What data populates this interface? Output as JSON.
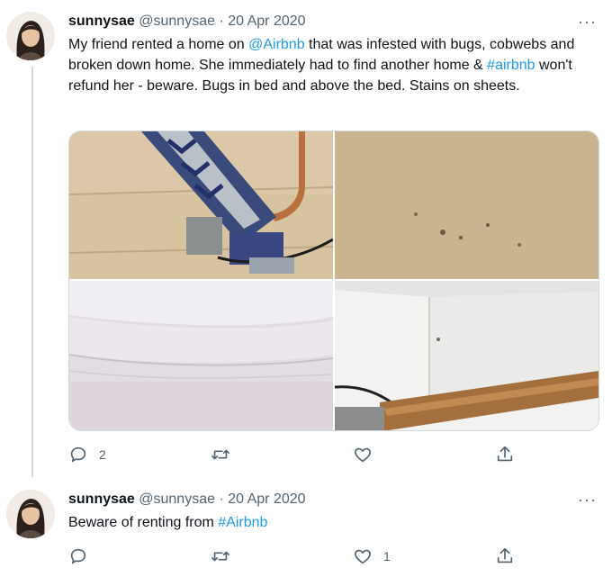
{
  "tweets": [
    {
      "name": "sunnysae",
      "handle": "@sunnysae",
      "separator": "·",
      "date": "20 Apr 2020",
      "text_parts": [
        {
          "t": "My friend rented a home on ",
          "link": false
        },
        {
          "t": "@Airbnb",
          "link": true
        },
        {
          "t": " that was infested with bugs, cobwebs and broken down home. She immediately had to find another home & ",
          "link": false
        },
        {
          "t": "#airbnb",
          "link": true
        },
        {
          "t": " won't refund her - beware. Bugs in bed and above the bed. Stains on sheets.",
          "link": false
        }
      ],
      "reply_count": "2",
      "retweet_count": "",
      "like_count": "",
      "has_media": true
    },
    {
      "name": "sunnysae",
      "handle": "@sunnysae",
      "separator": "·",
      "date": "20 Apr 2020",
      "text_parts": [
        {
          "t": "Beware of renting from ",
          "link": false
        },
        {
          "t": "#Airbnb",
          "link": true
        }
      ],
      "reply_count": "",
      "retweet_count": "",
      "like_count": "1",
      "has_media": false
    }
  ],
  "more_label": "···",
  "icons": [
    "reply-icon",
    "retweet-icon",
    "like-icon",
    "share-icon",
    "more-icon"
  ],
  "colors": {
    "link": "#1d9bf0",
    "muted": "#536471",
    "text": "#0f1419",
    "line": "#cfd9de"
  }
}
